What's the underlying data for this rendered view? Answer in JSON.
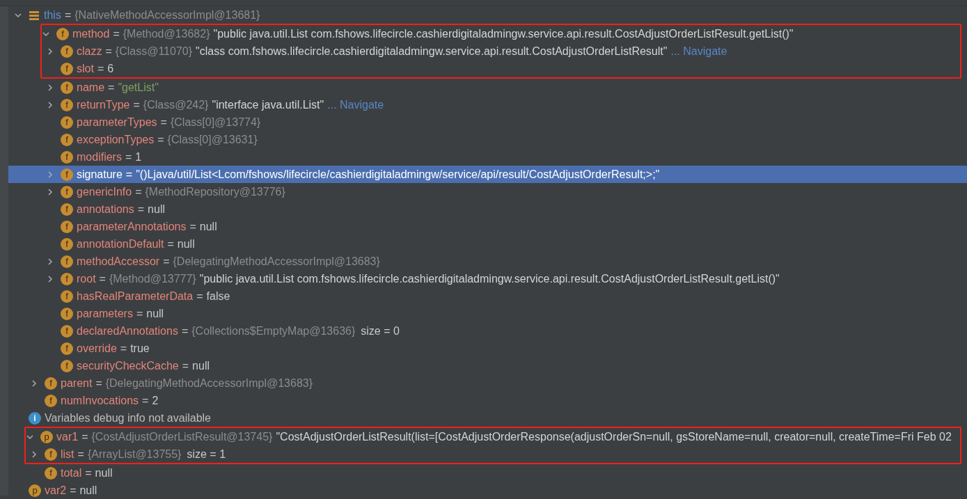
{
  "tree": [
    {
      "kind": "stack",
      "name": "this",
      "eq": "=",
      "ref": "{NativeMethodAccessorImpl@13681}",
      "expandable": true,
      "expanded": true,
      "selected": false,
      "boxed": false,
      "children": [
        {
          "kind": "field",
          "badge": "f",
          "name": "method",
          "eq": "=",
          "ref": "{Method@13682}",
          "value": {
            "kind": "string",
            "text": "\"public java.util.List com.fshows.lifecircle.cashierdigitaladmingw.service.api.result.CostAdjustOrderListResult.getList()\""
          },
          "expandable": true,
          "expanded": true,
          "selected": false,
          "boxed": true,
          "children": [
            {
              "kind": "field",
              "badge": "f",
              "name": "clazz",
              "eq": "=",
              "ref": "{Class@11070}",
              "value": {
                "kind": "string",
                "text": "\"class com.fshows.lifecircle.cashierdigitaladmingw.service.api.result.CostAdjustOrderListResult\""
              },
              "link": "... Navigate",
              "expandable": true,
              "expanded": false,
              "selected": false,
              "boxed": true
            },
            {
              "kind": "field",
              "badge": "f",
              "name": "slot",
              "eq": "=",
              "value": {
                "kind": "plain",
                "text": "6"
              },
              "expandable": false,
              "selected": false,
              "boxed": true
            },
            {
              "kind": "field",
              "badge": "f",
              "name": "name",
              "eq": "=",
              "value": {
                "kind": "literal",
                "text": "\"getList\""
              },
              "expandable": true,
              "expanded": false,
              "selected": false,
              "boxed": false
            },
            {
              "kind": "field",
              "badge": "f",
              "name": "returnType",
              "eq": "=",
              "ref": "{Class@242}",
              "value": {
                "kind": "string",
                "text": "\"interface java.util.List\""
              },
              "link": "... Navigate",
              "expandable": true,
              "expanded": false,
              "selected": false,
              "boxed": false
            },
            {
              "kind": "field",
              "badge": "f",
              "name": "parameterTypes",
              "eq": "=",
              "ref": "{Class[0]@13774}",
              "expandable": false,
              "selected": false,
              "boxed": false
            },
            {
              "kind": "field",
              "badge": "f",
              "name": "exceptionTypes",
              "eq": "=",
              "ref": "{Class[0]@13631}",
              "expandable": false,
              "selected": false,
              "boxed": false
            },
            {
              "kind": "field",
              "badge": "f",
              "name": "modifiers",
              "eq": "=",
              "value": {
                "kind": "plain",
                "text": "1"
              },
              "expandable": false,
              "selected": false,
              "boxed": false
            },
            {
              "kind": "field",
              "badge": "f",
              "name": "signature",
              "eq": "=",
              "value": {
                "kind": "string",
                "text": "\"()Ljava/util/List<Lcom/fshows/lifecircle/cashierdigitaladmingw/service/api/result/CostAdjustOrderResult;>;\""
              },
              "expandable": true,
              "expanded": false,
              "selected": true,
              "boxed": false
            },
            {
              "kind": "field",
              "badge": "f",
              "name": "genericInfo",
              "eq": "=",
              "ref": "{MethodRepository@13776}",
              "expandable": true,
              "expanded": false,
              "selected": false,
              "boxed": false
            },
            {
              "kind": "field",
              "badge": "f",
              "name": "annotations",
              "eq": "=",
              "value": {
                "kind": "plain",
                "text": "null"
              },
              "expandable": false,
              "selected": false,
              "boxed": false
            },
            {
              "kind": "field",
              "badge": "f",
              "name": "parameterAnnotations",
              "eq": "=",
              "value": {
                "kind": "plain",
                "text": "null"
              },
              "expandable": false,
              "selected": false,
              "boxed": false
            },
            {
              "kind": "field",
              "badge": "f",
              "name": "annotationDefault",
              "eq": "=",
              "value": {
                "kind": "plain",
                "text": "null"
              },
              "expandable": false,
              "selected": false,
              "boxed": false
            },
            {
              "kind": "field",
              "badge": "f",
              "name": "methodAccessor",
              "eq": "=",
              "ref": "{DelegatingMethodAccessorImpl@13683}",
              "expandable": true,
              "expanded": false,
              "selected": false,
              "boxed": false
            },
            {
              "kind": "field",
              "badge": "f",
              "name": "root",
              "eq": "=",
              "ref": "{Method@13777}",
              "value": {
                "kind": "string",
                "text": "\"public java.util.List com.fshows.lifecircle.cashierdigitaladmingw.service.api.result.CostAdjustOrderListResult.getList()\""
              },
              "expandable": true,
              "expanded": false,
              "selected": false,
              "boxed": false
            },
            {
              "kind": "field",
              "badge": "f",
              "name": "hasRealParameterData",
              "eq": "=",
              "value": {
                "kind": "plain",
                "text": "false"
              },
              "expandable": false,
              "selected": false,
              "boxed": false
            },
            {
              "kind": "field",
              "badge": "f",
              "name": "parameters",
              "eq": "=",
              "value": {
                "kind": "plain",
                "text": "null"
              },
              "expandable": false,
              "selected": false,
              "boxed": false
            },
            {
              "kind": "field",
              "badge": "f",
              "name": "declaredAnnotations",
              "eq": "=",
              "ref": "{Collections$EmptyMap@13636}",
              "size": "size = 0",
              "expandable": false,
              "selected": false,
              "boxed": false
            },
            {
              "kind": "field",
              "badge": "f",
              "name": "override",
              "eq": "=",
              "value": {
                "kind": "plain",
                "text": "true"
              },
              "expandable": false,
              "selected": false,
              "boxed": false
            },
            {
              "kind": "field",
              "badge": "f",
              "name": "securityCheckCache",
              "eq": "=",
              "value": {
                "kind": "plain",
                "text": "null"
              },
              "expandable": false,
              "selected": false,
              "boxed": false
            }
          ]
        },
        {
          "kind": "field",
          "badge": "f",
          "name": "parent",
          "eq": "=",
          "ref": "{DelegatingMethodAccessorImpl@13683}",
          "expandable": true,
          "expanded": false,
          "selected": false,
          "boxed": false
        },
        {
          "kind": "field",
          "badge": "f",
          "name": "numInvocations",
          "eq": "=",
          "value": {
            "kind": "plain",
            "text": "2"
          },
          "expandable": false,
          "selected": false,
          "boxed": false
        }
      ]
    },
    {
      "kind": "info",
      "badge": "i",
      "text": "Variables debug info not available",
      "expandable": false,
      "selected": false,
      "boxed": false
    },
    {
      "kind": "param",
      "badge": "p",
      "name": "var1",
      "eq": "=",
      "ref": "{CostAdjustOrderListResult@13745}",
      "value": {
        "kind": "string",
        "text": "\"CostAdjustOrderListResult(list=[CostAdjustOrderResponse(adjustOrderSn=null, gsStoreName=null, creator=null, createTime=Fri Feb 02"
      },
      "expandable": true,
      "expanded": true,
      "selected": false,
      "boxed": true,
      "children": [
        {
          "kind": "field",
          "badge": "f",
          "name": "list",
          "eq": "=",
          "ref": "{ArrayList@13755}",
          "size": "size = 1",
          "expandable": true,
          "expanded": false,
          "selected": false,
          "boxed": true
        },
        {
          "kind": "field",
          "badge": "f",
          "name": "total",
          "eq": "=",
          "value": {
            "kind": "plain",
            "text": "null"
          },
          "expandable": false,
          "selected": false,
          "boxed": false
        }
      ]
    },
    {
      "kind": "param",
      "badge": "p",
      "name": "var2",
      "eq": "=",
      "value": {
        "kind": "plain",
        "text": "null"
      },
      "expandable": false,
      "selected": false,
      "boxed": false
    }
  ]
}
